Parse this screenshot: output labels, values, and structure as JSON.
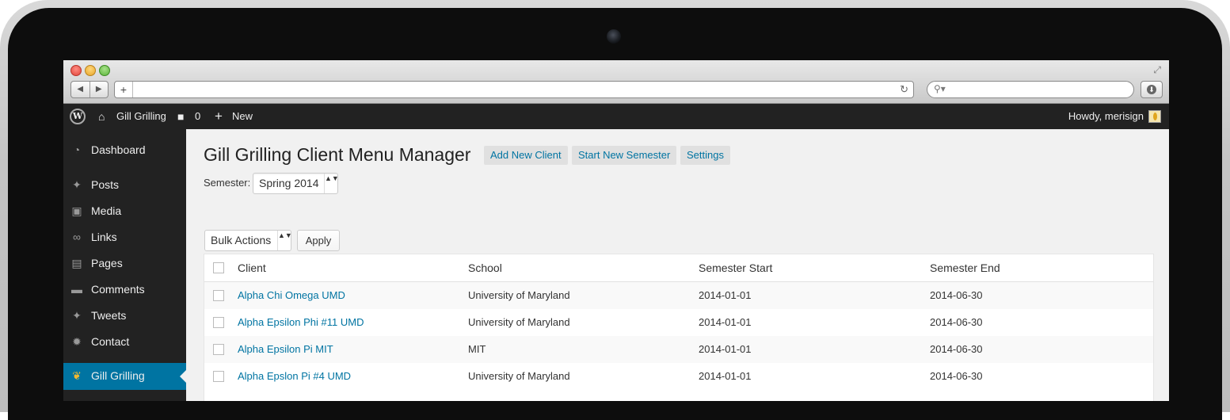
{
  "browser": {
    "nav_back": "◀",
    "nav_forward": "▶",
    "new_tab": "+",
    "reload_icon": "↻",
    "search_icon": "⚲▾",
    "download_icon": "⬇",
    "resize_icon": "⤢"
  },
  "admin_bar": {
    "wp_logo": "W",
    "home_icon": "⌂",
    "site_name": "Gill Grilling",
    "comment_icon": "■",
    "comments_count": "0",
    "new_icon": "+",
    "new_label": "New",
    "howdy": "Howdy, merisign"
  },
  "sidebar": {
    "items": [
      {
        "label": "Dashboard",
        "icon": "dashboard-icon",
        "glyph": "◔"
      },
      {
        "label": "Posts",
        "icon": "pin-icon",
        "glyph": "✦"
      },
      {
        "label": "Media",
        "icon": "media-icon",
        "glyph": "▣"
      },
      {
        "label": "Links",
        "icon": "link-icon",
        "glyph": "∞"
      },
      {
        "label": "Pages",
        "icon": "pages-icon",
        "glyph": "▤"
      },
      {
        "label": "Comments",
        "icon": "comment-icon",
        "glyph": "▬"
      },
      {
        "label": "Tweets",
        "icon": "pin-icon",
        "glyph": "✦"
      },
      {
        "label": "Contact",
        "icon": "gear-icon",
        "glyph": "✹"
      },
      {
        "label": "Gill Grilling",
        "icon": "flame-icon",
        "glyph": "❦",
        "active": true
      }
    ]
  },
  "main": {
    "title": "Gill Grilling Client Menu Manager",
    "buttons": {
      "add_client": "Add New Client",
      "start_semester": "Start New Semester",
      "settings": "Settings"
    },
    "semester_label": "Semester:",
    "semester_value": "Spring 2014",
    "bulk_actions": "Bulk Actions",
    "apply": "Apply",
    "updown": "▲▼"
  },
  "table": {
    "columns": [
      "Client",
      "School",
      "Semester Start",
      "Semester End"
    ],
    "rows": [
      {
        "client": "Alpha Chi Omega UMD",
        "school": "University of Maryland",
        "start": "2014-01-01",
        "end": "2014-06-30"
      },
      {
        "client": "Alpha Epsilon Phi #11 UMD",
        "school": "University of Maryland",
        "start": "2014-01-01",
        "end": "2014-06-30"
      },
      {
        "client": "Alpha Epsilon Pi MIT",
        "school": "MIT",
        "start": "2014-01-01",
        "end": "2014-06-30"
      },
      {
        "client": "Alpha Epslon Pi #4 UMD",
        "school": "University of Maryland",
        "start": "2014-01-01",
        "end": "2014-06-30"
      }
    ]
  },
  "colors": {
    "admin_bar": "#222222",
    "accent": "#0074a2",
    "content_bg": "#f1f1f1"
  }
}
